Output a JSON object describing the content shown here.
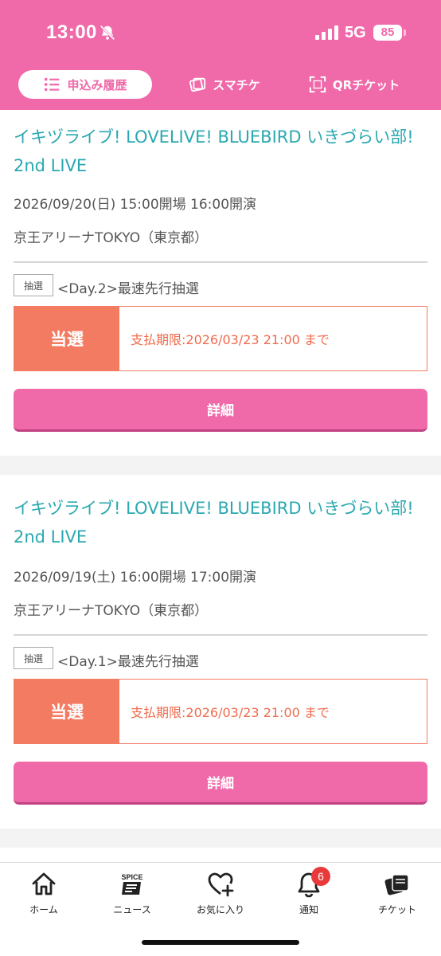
{
  "status_bar": {
    "time": "13:00",
    "network": "5G",
    "battery": "85"
  },
  "tabs": [
    {
      "label": "申込み履歴",
      "icon": "list-icon",
      "active": true
    },
    {
      "label": "スマチケ",
      "icon": "smart-ticket-icon",
      "active": false
    },
    {
      "label": "QRチケット",
      "icon": "qr-scan-icon",
      "active": false
    }
  ],
  "applications": [
    {
      "title": "イキヅライブ! LOVELIVE! BLUEBIRD いきづらい部! 2nd LIVE",
      "datetime": "2026/09/20(日) 15:00開場 16:00開演",
      "venue": "京王アリーナTOKYO（東京都）",
      "lottery_badge": "抽選",
      "lottery_name": "<Day.2>最速先行抽選",
      "result_status": "当選",
      "deadline": "支払期限:2026/03/23 21:00 まで",
      "detail_label": "詳細"
    },
    {
      "title": "イキヅライブ! LOVELIVE! BLUEBIRD いきづらい部! 2nd LIVE",
      "datetime": "2026/09/19(土) 16:00開場 17:00開演",
      "venue": "京王アリーナTOKYO（東京都）",
      "lottery_badge": "抽選",
      "lottery_name": "<Day.1>最速先行抽選",
      "result_status": "当選",
      "deadline": "支払期限:2026/03/23 21:00 まで",
      "detail_label": "詳細"
    }
  ],
  "bottom_nav": [
    {
      "label": "ホーム",
      "icon": "home-icon"
    },
    {
      "label": "ニュース",
      "icon": "spice-news-icon",
      "icon_text": "SPICE"
    },
    {
      "label": "お気に入り",
      "icon": "heart-plus-icon"
    },
    {
      "label": "通知",
      "icon": "bell-icon",
      "badge": "6"
    },
    {
      "label": "チケット",
      "icon": "tickets-icon"
    }
  ],
  "colors": {
    "brand_pink": "#f06aaa",
    "title_teal": "#2aa8b0",
    "win_orange": "#f37b62"
  }
}
